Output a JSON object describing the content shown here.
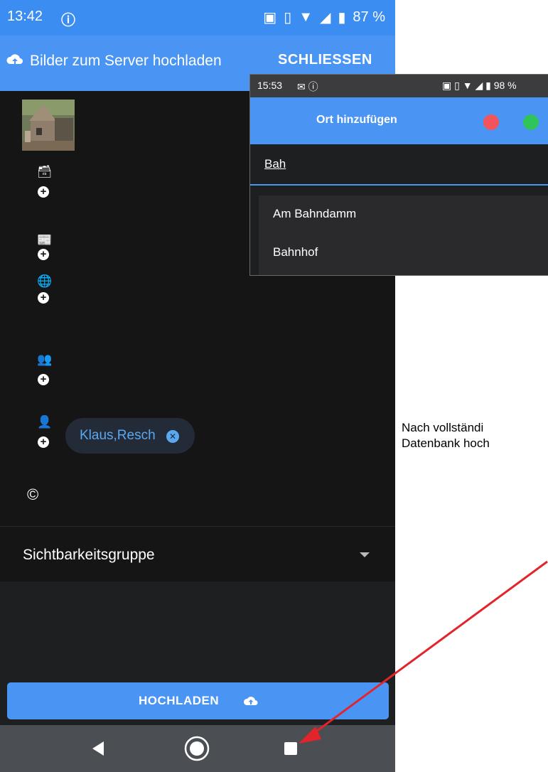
{
  "status_bar": {
    "time": "13:42",
    "battery": "87 %"
  },
  "app_bar": {
    "title": "Bilder zum Server hochladen",
    "close_label": "SCHLIESSEN"
  },
  "content": {
    "chip_label": "Klaus,Resch",
    "copyright_symbol": "©",
    "visibility_group_label": "Sichtbarkeitsgruppe"
  },
  "upload_button_label": "HOCHLADEN",
  "dialog": {
    "status_time": "15:53",
    "status_battery": "98 %",
    "title": "Ort hinzufügen",
    "input_value": "Bah",
    "suggestions": [
      "Am Bahndamm",
      "Bahnhof"
    ]
  },
  "caption": {
    "line1": "Nach vollständi",
    "line2": "Datenbank hoch"
  },
  "colors": {
    "accent": "#4a95f4",
    "status_bar": "#3b8df1",
    "chip_text": "#5aa8f0",
    "cancel": "#f2545b",
    "confirm": "#30c45a",
    "arrow": "#e3242b"
  }
}
